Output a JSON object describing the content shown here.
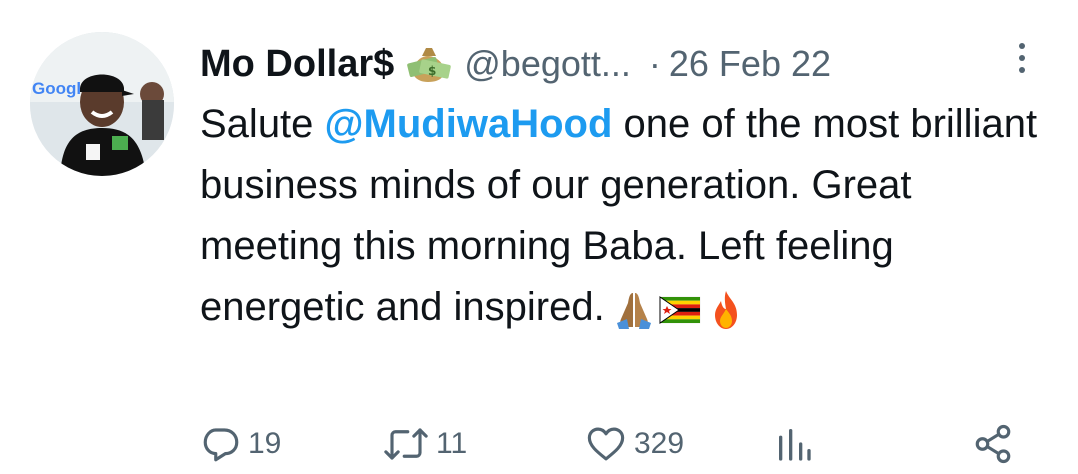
{
  "author": {
    "name": "Mo Dollar$",
    "handle": "@begott...",
    "badge": "money-bag-emoji",
    "avatar": "profile-photo"
  },
  "meta": {
    "separator": "·",
    "date": "26 Feb 22"
  },
  "tweet": {
    "text_before": "Salute ",
    "mention": "@MudiwaHood",
    "text_after": " one of the most brilliant business minds of our generation. Great meeting this morning Baba. Left feeling energetic and inspired.",
    "emojis": [
      "folded-hands-emoji",
      "zimbabwe-flag-emoji",
      "fire-emoji"
    ]
  },
  "actions": {
    "replies": "19",
    "retweets": "11",
    "likes": "329",
    "views": "",
    "icons": [
      "reply-icon",
      "retweet-icon",
      "like-icon",
      "views-icon",
      "share-icon"
    ]
  },
  "colors": {
    "text": "#0f1419",
    "secondary": "#536471",
    "link": "#1d9bf0"
  }
}
